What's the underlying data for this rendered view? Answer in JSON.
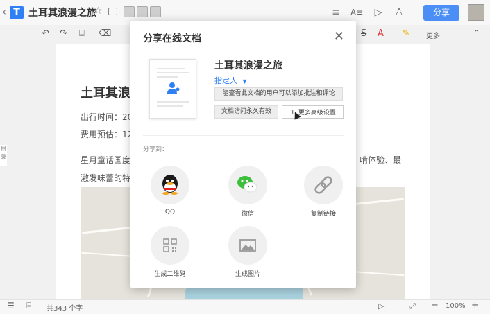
{
  "header": {
    "back_icon": "chevron-left-icon",
    "title": "土耳其浪漫之旅",
    "share_label": "分享"
  },
  "document": {
    "heading": "土耳其浪",
    "line1": "出行时间：202",
    "line2": "费用预估：120",
    "para_left": "星月童话国度—",
    "para_right": "啃体验、最",
    "para_left2": "激发味蕾的特色",
    "side_tab": "目录"
  },
  "toolbar": {
    "more_label": "更多"
  },
  "status": {
    "word_count": "共343 个字",
    "zoom": "100%",
    "minus": "−",
    "plus": "+"
  },
  "share_dialog": {
    "title": "分享在线文档",
    "doc_name": "土耳其浪漫之旅",
    "permission_label": "指定人",
    "permission_option": "能查看此文档的用户可以添加批注和评论",
    "validity_option": "文档访问永久有效",
    "advanced_label": "更多高级设置",
    "share_to_label": "分享到：",
    "targets": [
      {
        "label": "QQ",
        "icon": "qq-icon"
      },
      {
        "label": "微信",
        "icon": "wechat-icon"
      },
      {
        "label": "复制链接",
        "icon": "link-icon"
      },
      {
        "label": "生成二维码",
        "icon": "qrcode-icon"
      },
      {
        "label": "生成图片",
        "icon": "image-icon"
      }
    ]
  },
  "colors": {
    "accent": "#4b8ef6",
    "link_blue": "#2f7ff5"
  }
}
